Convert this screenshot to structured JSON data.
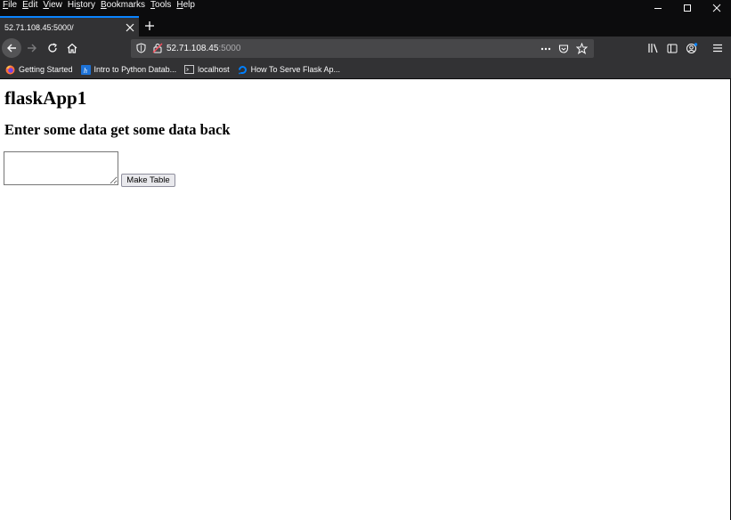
{
  "menubar": {
    "items": [
      {
        "key": "F",
        "rest": "ile"
      },
      {
        "key": "E",
        "rest": "dit"
      },
      {
        "key": "V",
        "rest": "iew"
      },
      {
        "pre": "Hi",
        "key": "s",
        "rest": "tory"
      },
      {
        "key": "B",
        "rest": "ookmarks"
      },
      {
        "key": "T",
        "rest": "ools"
      },
      {
        "key": "H",
        "rest": "elp"
      }
    ]
  },
  "tab": {
    "title": "52.71.108.45:5000/"
  },
  "urlbar": {
    "host": "52.71.108.45",
    "port": ":5000"
  },
  "bookmarks": [
    {
      "label": "Getting Started",
      "icon": "firefox-icon"
    },
    {
      "label": "Intro to Python Datab...",
      "icon": "h-icon"
    },
    {
      "label": "localhost",
      "icon": "terminal-icon"
    },
    {
      "label": "How To Serve Flask Ap...",
      "icon": "digitalocean-icon"
    }
  ],
  "page": {
    "title": "flaskApp1",
    "subtitle": "Enter some data get some data back",
    "textarea_value": "",
    "button_label": "Make Table"
  },
  "colors": {
    "chrome_dark": "#0c0c0d",
    "toolbar": "#323234",
    "urlbar": "#474749",
    "tab_accent": "#0a84ff"
  }
}
